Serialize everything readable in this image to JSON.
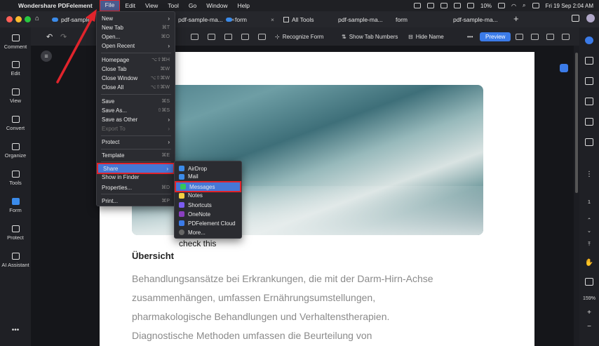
{
  "menubar": {
    "app_name": "Wondershare PDFelement",
    "items": [
      "File",
      "Edit",
      "View",
      "Tool",
      "Go",
      "Window",
      "Help"
    ],
    "battery": "10%",
    "datetime": "Fri 19 Sep  2:04 AM"
  },
  "tabs": [
    {
      "label": "pdf-sample"
    },
    {
      "label": "pdf-sample-ma..."
    },
    {
      "label": "form"
    },
    {
      "label": "All Tools"
    },
    {
      "label": "pdf-sample-ma..."
    },
    {
      "label": "form"
    },
    {
      "label": "pdf-sample-ma..."
    }
  ],
  "toolbar": {
    "recognize_form": "Recognize Form",
    "show_tab_numbers": "Show Tab Numbers",
    "hide_name": "Hide Name",
    "preview": "Preview"
  },
  "sidebar": {
    "items": [
      "Comment",
      "Edit",
      "View",
      "Convert",
      "Organize",
      "Tools",
      "Form",
      "Protect",
      "AI Assistant"
    ]
  },
  "file_menu": {
    "items": [
      {
        "label": "New",
        "shortcut": ""
      },
      {
        "label": "New Tab",
        "shortcut": "⌘T"
      },
      {
        "label": "Open...",
        "shortcut": "⌘O"
      },
      {
        "label": "Open Recent",
        "shortcut": ""
      },
      {
        "label": "Homepage",
        "shortcut": "⌥⇧⌘H"
      },
      {
        "label": "Close Tab",
        "shortcut": "⌘W"
      },
      {
        "label": "Close Window",
        "shortcut": "⌥⇧⌘W"
      },
      {
        "label": "Close All",
        "shortcut": "⌥⇧⌘W"
      },
      {
        "label": "Save",
        "shortcut": "⌘S"
      },
      {
        "label": "Save As...",
        "shortcut": "⇧⌘S"
      },
      {
        "label": "Save as Other",
        "shortcut": ""
      },
      {
        "label": "Export To",
        "shortcut": ""
      },
      {
        "label": "Protect",
        "shortcut": ""
      },
      {
        "label": "Template",
        "shortcut": "⌘E"
      },
      {
        "label": "Share",
        "shortcut": ""
      },
      {
        "label": "Show in Finder",
        "shortcut": ""
      },
      {
        "label": "Properties...",
        "shortcut": "⌘D"
      },
      {
        "label": "Print...",
        "shortcut": "⌘P"
      }
    ]
  },
  "share_menu": {
    "items": [
      "AirDrop",
      "Mail",
      "Messages",
      "Notes",
      "Shortcuts",
      "OneNote",
      "PDFelement Cloud",
      "More..."
    ]
  },
  "right_sidebar": {
    "page_number": "1",
    "zoom": "159%"
  },
  "document": {
    "note": "check this",
    "heading": "Übersicht",
    "lines": [
      "Behandlungsansätze bei Erkrankungen, die mit der Darm-Hirn-Achse",
      "zusammenhängen, umfassen Ernährungsumstellungen,",
      "pharmakologische Behandlungen und Verhaltenstherapien.",
      "Diagnostische Methoden umfassen die Beurteilung von"
    ]
  },
  "colors": {
    "accent": "#3b7be8",
    "highlight_border": "#e0242c",
    "menu_bg": "#2b2c31"
  }
}
